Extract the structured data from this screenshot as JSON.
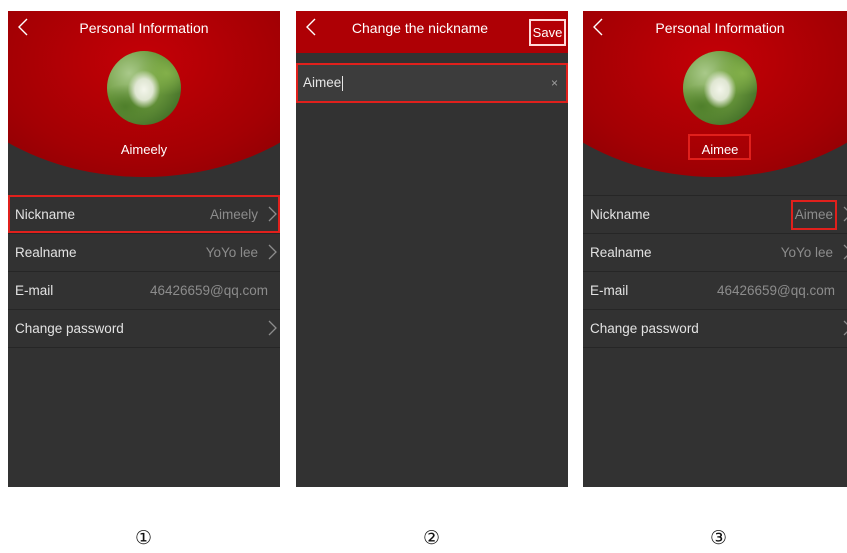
{
  "screen1": {
    "title": "Personal Information",
    "name": "Aimeely",
    "rows": [
      {
        "label": "Nickname",
        "value": "Aimeely"
      },
      {
        "label": "Realname",
        "value": "YoYo lee"
      },
      {
        "label": "E-mail",
        "value": "46426659@qq.com"
      },
      {
        "label": "Change password",
        "value": ""
      }
    ],
    "step": "①"
  },
  "screen2": {
    "title": "Change the nickname",
    "save_label": "Save",
    "input_value": "Aimee",
    "clear_icon": "×",
    "step": "②"
  },
  "screen3": {
    "title": "Personal Information",
    "name": "Aimee",
    "rows": [
      {
        "label": "Nickname",
        "value": "Aimee"
      },
      {
        "label": "Realname",
        "value": "YoYo lee"
      },
      {
        "label": "E-mail",
        "value": "46426659@qq.com"
      },
      {
        "label": "Change password",
        "value": ""
      }
    ],
    "step": "③"
  },
  "colors": {
    "header_red": "#b00004",
    "panel": "#323232",
    "highlight": "#e0201c"
  },
  "icons": [
    "back-arrow-icon",
    "chevron-right-icon",
    "clear-icon"
  ]
}
